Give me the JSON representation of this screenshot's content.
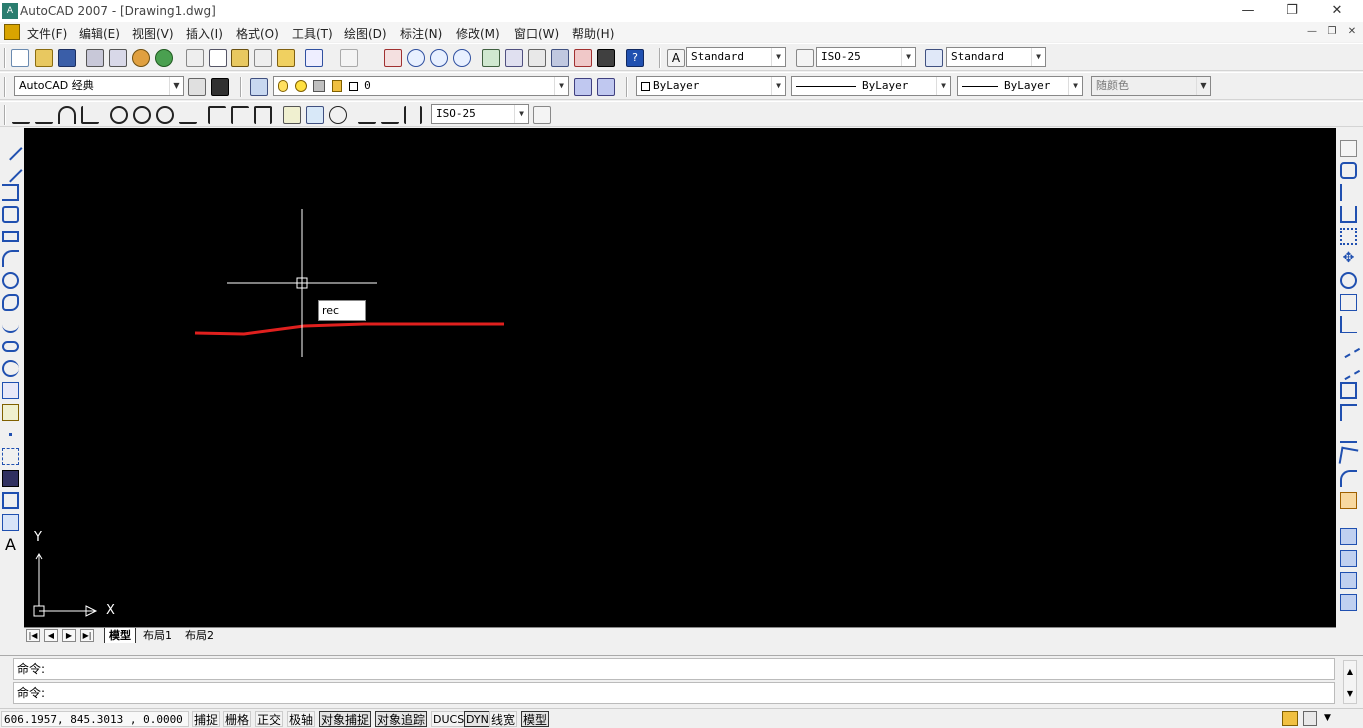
{
  "titlebar": {
    "app_icon": "A",
    "title": "AutoCAD 2007 - [Drawing1.dwg]"
  },
  "menubar": {
    "items": [
      "文件(F)",
      "编辑(E)",
      "视图(V)",
      "插入(I)",
      "格式(O)",
      "工具(T)",
      "绘图(D)",
      "标注(N)",
      "修改(M)",
      "窗口(W)",
      "帮助(H)"
    ]
  },
  "toolbar": {
    "text_style": "Standard",
    "dim_style": "ISO-25",
    "table_style": "Standard",
    "workspace": "AutoCAD 经典",
    "layer": "0",
    "color": "ByLayer",
    "linetype": "ByLayer",
    "lineweight": "ByLayer",
    "plot_style": "随颜色",
    "dim_style_2": "ISO-25"
  },
  "canvas": {
    "dynamic_input": "rec",
    "ucs_x": "X",
    "ucs_y": "Y",
    "colors": {
      "background": "#000000",
      "line": "#e0201e",
      "crosshair": "#ffffff"
    }
  },
  "tabs": {
    "items": [
      "模型",
      "布局1",
      "布局2"
    ]
  },
  "command": {
    "line1": "命令:",
    "line2": "命令:"
  },
  "status": {
    "coords": "606.1957,  845.3013 , 0.0000",
    "toggles": [
      "捕捉",
      "栅格",
      "正交",
      "极轴",
      "对象捕捉",
      "对象追踪",
      "DUCS",
      "DYN",
      "线宽",
      "模型"
    ]
  }
}
